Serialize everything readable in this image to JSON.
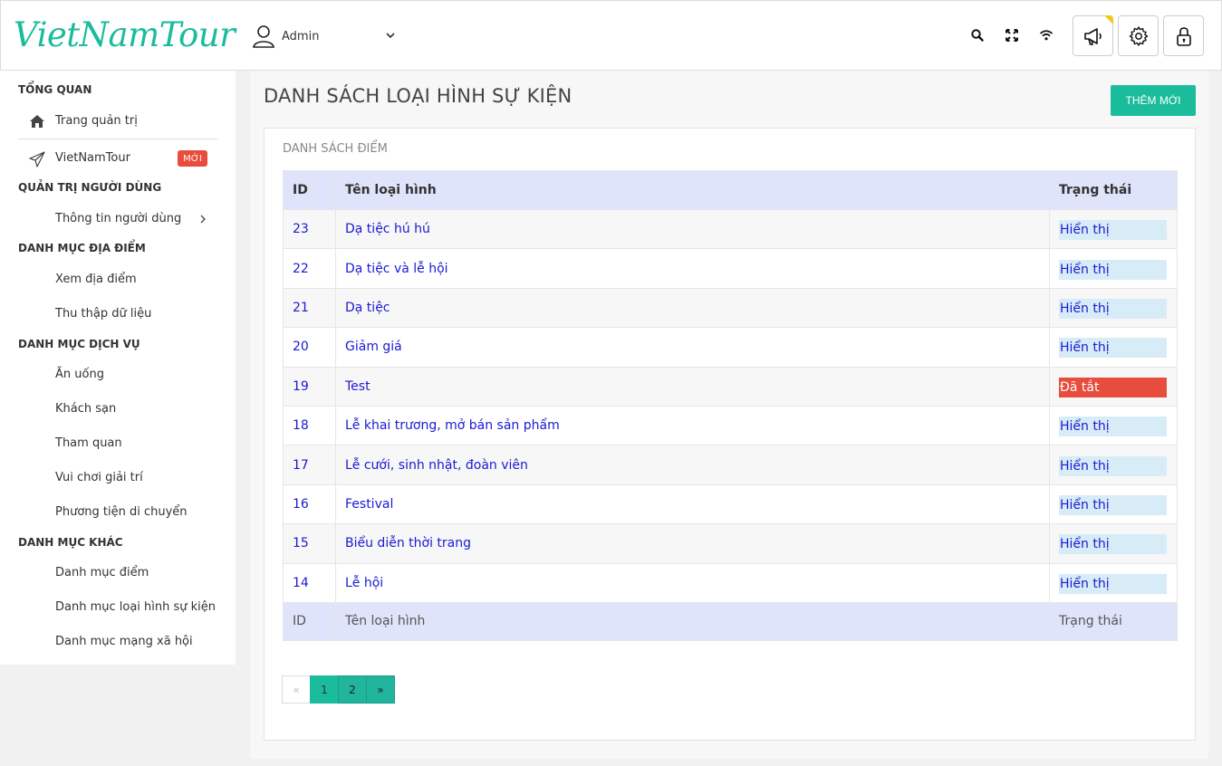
{
  "header": {
    "logo": "VietNamTour",
    "user_name": "Admin",
    "icons": [
      "search-icon",
      "fullscreen-icon",
      "wifi-icon",
      "megaphone-icon",
      "gear-icon",
      "lock-icon"
    ]
  },
  "sidebar": {
    "sections": {
      "overview": "TỔNG QUAN",
      "users": "QUẢN TRỊ NGƯỜI DÙNG",
      "places": "DANH MỤC ĐỊA ĐIỂM",
      "services": "DANH MỤC DỊCH VỤ",
      "other": "DANH MỤC KHÁC"
    },
    "items": {
      "admin_home": "Trang quản trị",
      "vietnamtour": "VietNamTour",
      "new_badge": "MỚI",
      "user_info": "Thông tin người dùng",
      "view_places": "Xem địa điểm",
      "collect_data": "Thu thập dữ liệu",
      "food": "Ăn uống",
      "hotel": "Khách sạn",
      "sightseeing": "Tham quan",
      "entertainment": "Vui chơi giải trí",
      "transport": "Phương tiện di chuyển",
      "point_categories": "Danh mục điểm",
      "event_types": "Danh mục loại hình sự kiện",
      "social": "Danh mục mạng xã hội"
    }
  },
  "main": {
    "title": "DANH SÁCH LOẠI HÌNH SỰ KIỆN",
    "add_button": "THÊM MỚI",
    "panel_title": "DANH SÁCH ĐIỂM",
    "columns": {
      "id": "ID",
      "name": "Tên loại hình",
      "status": "Trạng thái"
    },
    "rows": [
      {
        "id": "23",
        "name": "Dạ tiệc hú hú",
        "status": "Hiển thị",
        "active": true
      },
      {
        "id": "22",
        "name": "Dạ tiệc và lễ hội",
        "status": "Hiển thị",
        "active": true
      },
      {
        "id": "21",
        "name": "Dạ tiệc",
        "status": "Hiển thị",
        "active": true
      },
      {
        "id": "20",
        "name": "Giảm giá",
        "status": "Hiển thị",
        "active": true
      },
      {
        "id": "19",
        "name": "Test",
        "status": "Đã tắt",
        "active": false
      },
      {
        "id": "18",
        "name": "Lễ khai trương, mở bán sản phẩm",
        "status": "Hiển thị",
        "active": true
      },
      {
        "id": "17",
        "name": "Lễ cưới, sinh nhật, đoàn viên",
        "status": "Hiển thị",
        "active": true
      },
      {
        "id": "16",
        "name": "Festival",
        "status": "Hiển thị",
        "active": true
      },
      {
        "id": "15",
        "name": "Biểu diễn thời trang",
        "status": "Hiển thị",
        "active": true
      },
      {
        "id": "14",
        "name": "Lễ hội",
        "status": "Hiển thị",
        "active": true
      }
    ],
    "pagination": {
      "prev": "«",
      "pages": [
        "1",
        "2"
      ],
      "current": "1",
      "next": "»"
    }
  },
  "colors": {
    "accent": "#1abc9c",
    "danger": "#e74c3c",
    "link": "#1a1ad4",
    "table_header": "#e0e4fb"
  }
}
